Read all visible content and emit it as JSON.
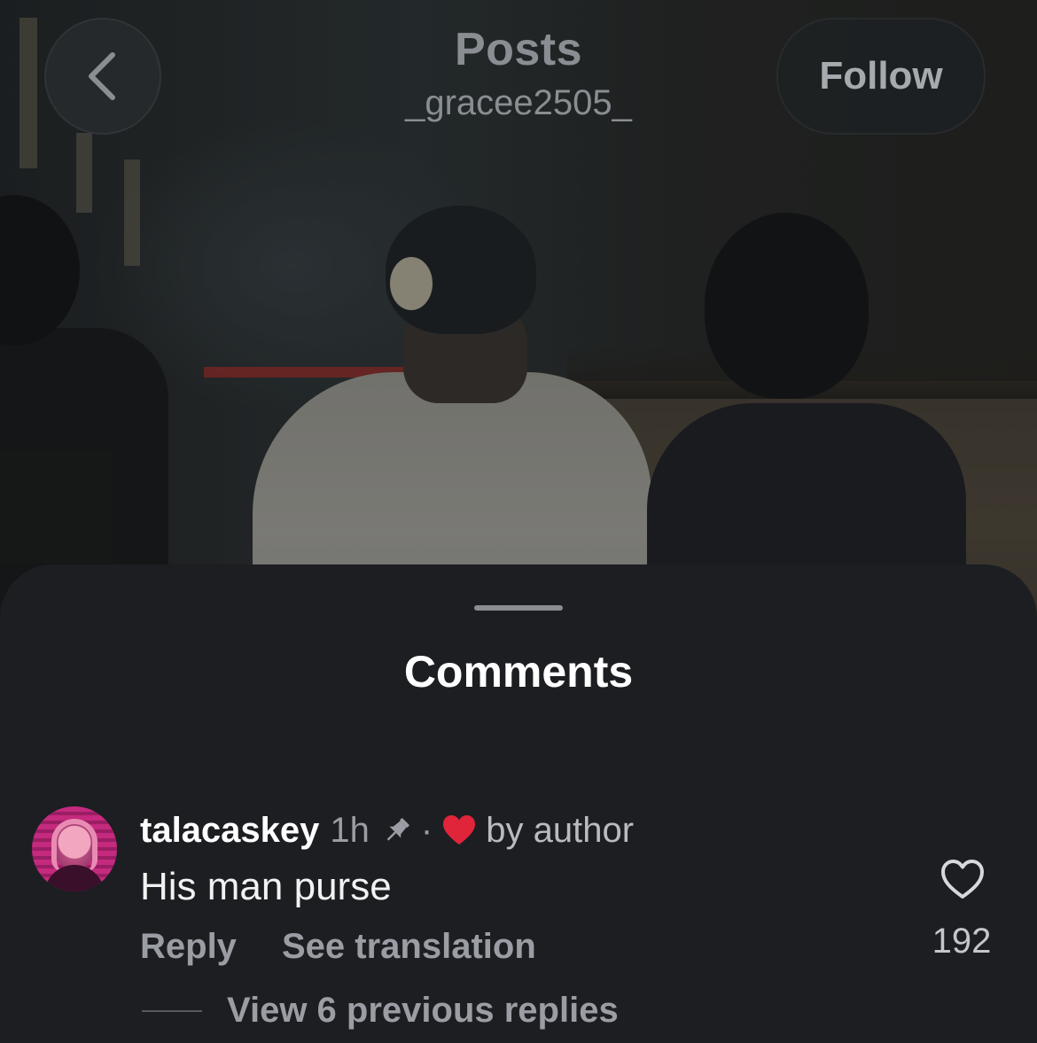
{
  "header": {
    "title": "Posts",
    "username": "_gracee2505_",
    "follow_label": "Follow",
    "back_icon": "chevron-left-icon"
  },
  "comments_sheet": {
    "title": "Comments",
    "comments": [
      {
        "username": "talacaskey",
        "time": "1h",
        "pinned": true,
        "liked_by_author_label": "by author",
        "text": "His man purse",
        "reply_label": "Reply",
        "translate_label": "See translation",
        "like_count": "192",
        "view_replies_label": "View 6 previous replies"
      }
    ]
  },
  "colors": {
    "sheet_bg": "#1c1e22",
    "heart_red": "#e0243a",
    "muted_text": "#9a9da3"
  }
}
